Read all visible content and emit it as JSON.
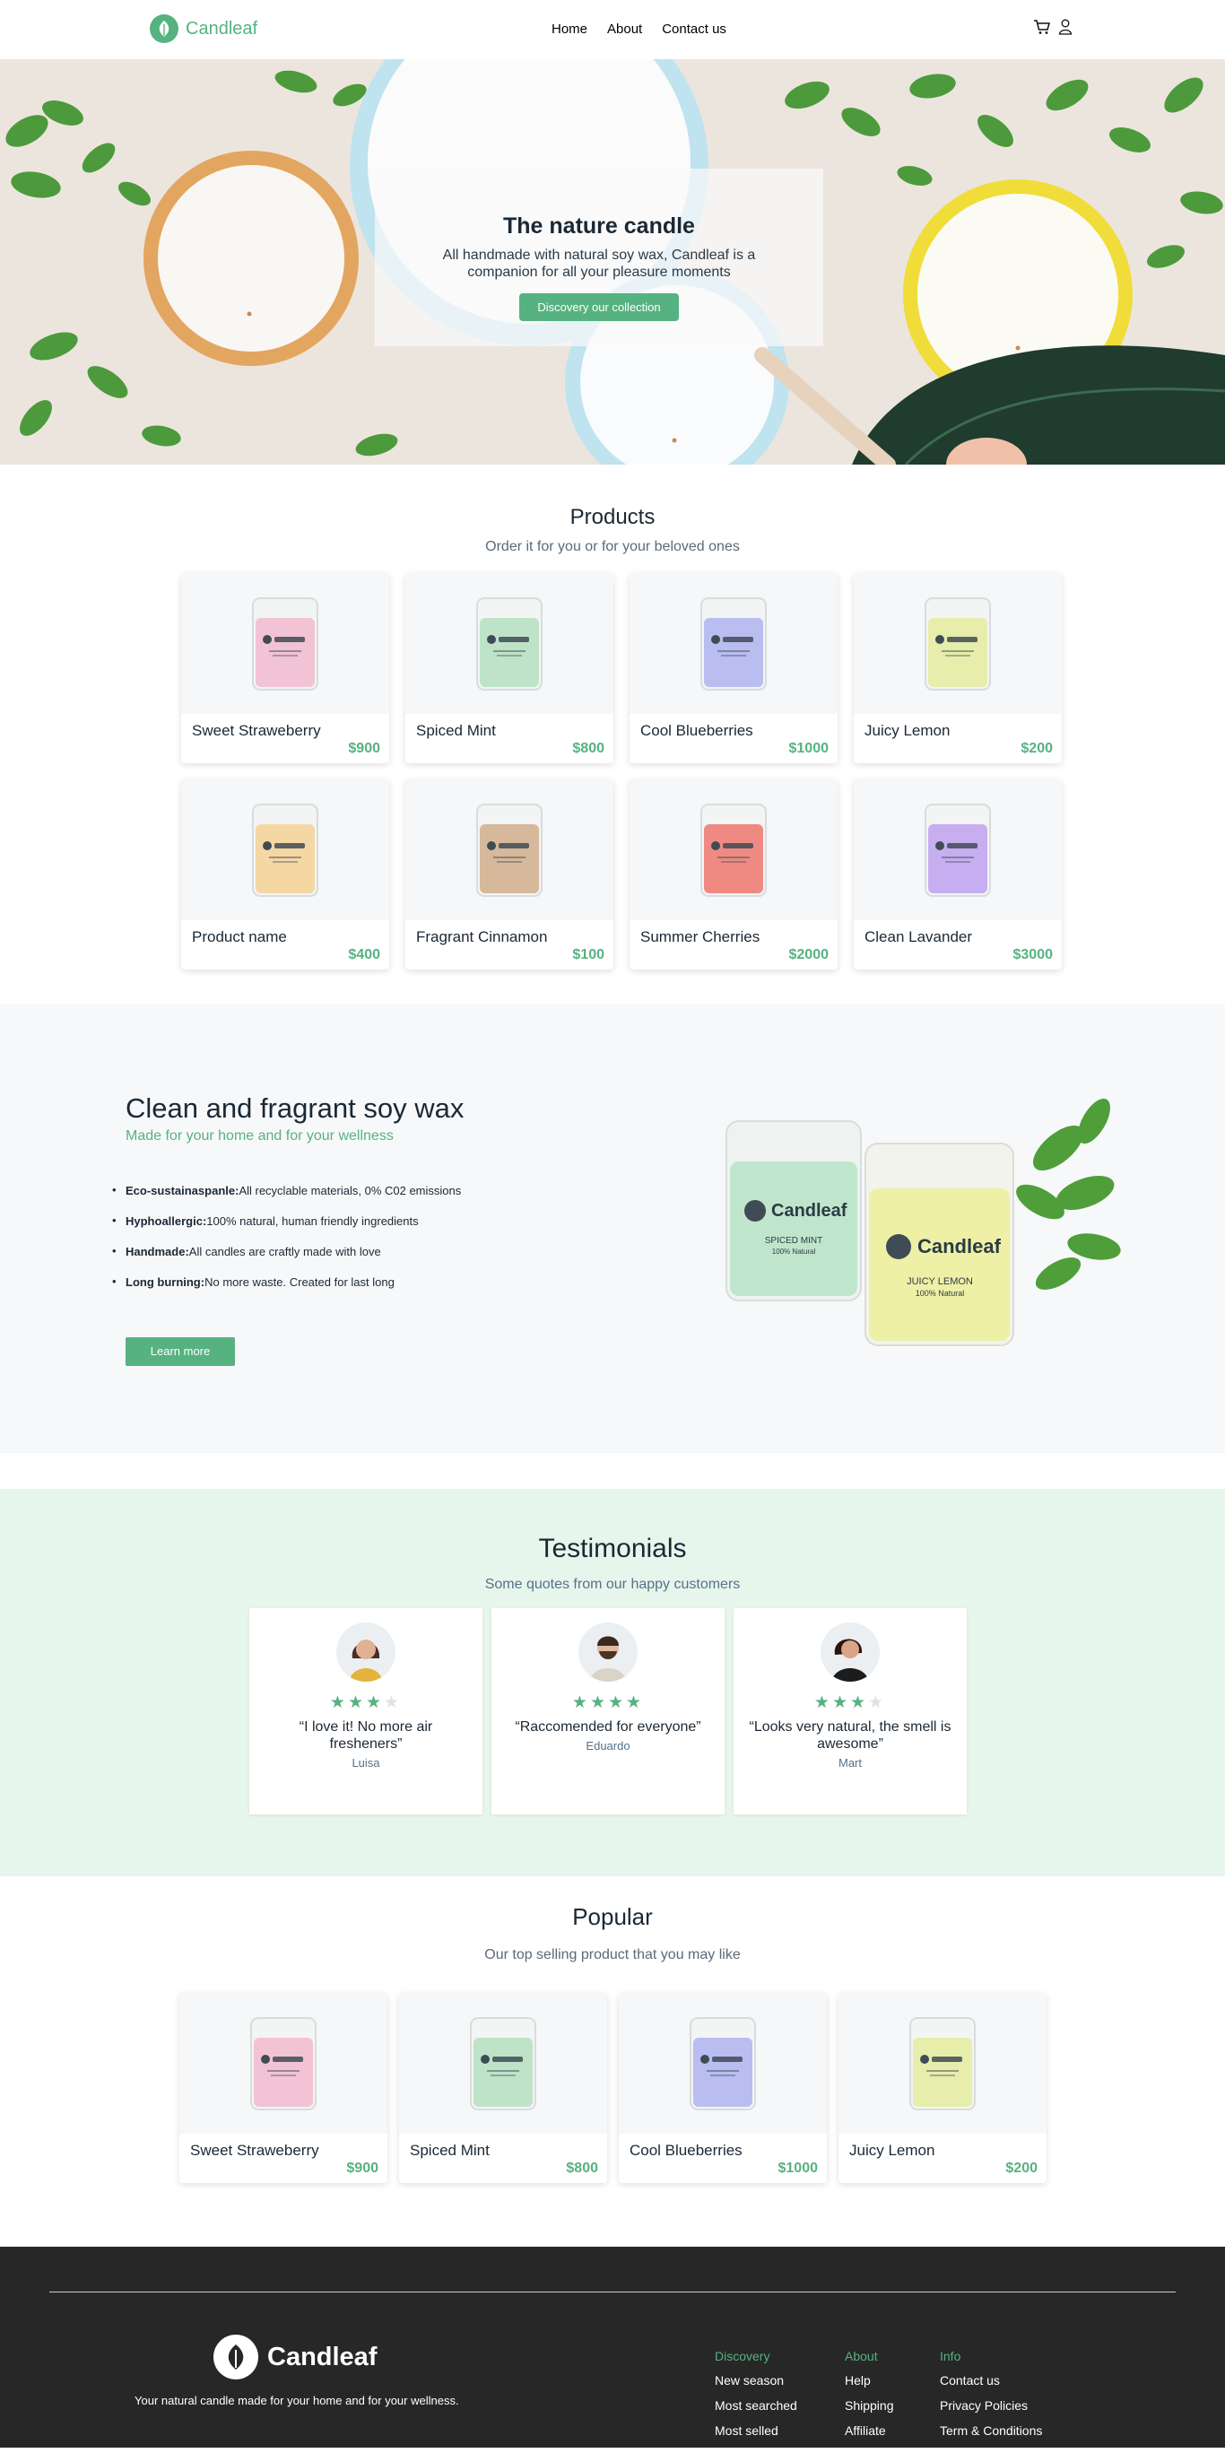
{
  "nav": {
    "brand": "Candleaf",
    "menu": [
      "Home",
      "About",
      "Contact us"
    ]
  },
  "hero": {
    "title": "The nature candle",
    "subtitle": "All handmade with natural soy wax, Candleaf is a companion for all your pleasure moments",
    "cta": "Discovery our collection"
  },
  "products": {
    "title": "Products",
    "subtitle": "Order it for you or for your beloved ones",
    "items": [
      {
        "name": "Sweet Straweberry",
        "price": "$900",
        "color": "#f2c3d4"
      },
      {
        "name": "Spiced Mint",
        "price": "$800",
        "color": "#bfe3c9"
      },
      {
        "name": "Cool Blueberries",
        "price": "$1000",
        "color": "#b9bdf0"
      },
      {
        "name": "Juicy Lemon",
        "price": "$200",
        "color": "#e7edaa"
      },
      {
        "name": "Product name",
        "price": "$400",
        "color": "#f4d7a2"
      },
      {
        "name": "Fragrant Cinnamon",
        "price": "$100",
        "color": "#d6b89b"
      },
      {
        "name": "Summer Cherries",
        "price": "$2000",
        "color": "#ef8a83"
      },
      {
        "name": "Clean Lavander",
        "price": "$3000",
        "color": "#c7aef0"
      }
    ]
  },
  "features": {
    "title": "Clean and fragrant soy wax",
    "subtitle": "Made for your home and for your wellness",
    "bullets": [
      {
        "label": "Eco-sustainaspanle:",
        "text": "All recyclable materials, 0% C02 emissions"
      },
      {
        "label": "Hyphoallergic:",
        "text": "100% natural, human friendly ingredients"
      },
      {
        "label": "Handmade:",
        "text": "All candles are craftly made with love"
      },
      {
        "label": "Long burning:",
        "text": "No more waste. Created for last long"
      }
    ],
    "cta": "Learn more",
    "jar_brand": "Candleaf",
    "jar_mint": "SPICED MINT",
    "jar_lemon": "JUICY LEMON",
    "jar_natural": "100% Natural"
  },
  "testimonials": {
    "title": "Testimonials",
    "subtitle": "Some quotes from our happy customers",
    "items": [
      {
        "quote": "“I love it! No more air fresheners”",
        "name": "Luisa",
        "rating": 3
      },
      {
        "quote": "“Raccomended for everyone”",
        "name": "Eduardo",
        "rating": 4
      },
      {
        "quote": "“Looks very natural, the smell is awesome”",
        "name": "Mart",
        "rating": 3
      }
    ]
  },
  "popular": {
    "title": "Popular",
    "subtitle": "Our top selling product that you may like",
    "items": [
      {
        "name": "Sweet Straweberry",
        "price": "$900",
        "color": "#f2c3d4"
      },
      {
        "name": "Spiced Mint",
        "price": "$800",
        "color": "#bfe3c9"
      },
      {
        "name": "Cool Blueberries",
        "price": "$1000",
        "color": "#b9bdf0"
      },
      {
        "name": "Juicy Lemon",
        "price": "$200",
        "color": "#e7edaa"
      }
    ]
  },
  "footer": {
    "brand": "Candleaf",
    "tagline": "Your natural candle made for your home and for your wellness.",
    "columns": [
      {
        "title": "Discovery",
        "links": [
          "New season",
          "Most searched",
          "Most selled"
        ]
      },
      {
        "title": "About",
        "links": [
          "Help",
          "Shipping",
          "Affiliate"
        ]
      },
      {
        "title": "Info",
        "links": [
          "Contact us",
          "Privacy Policies",
          "Term & Conditions"
        ]
      }
    ]
  },
  "colors": {
    "accent": "#56b280",
    "dark": "#1b2834",
    "footer_bg": "#272727",
    "testimonial_bg": "#e7f6ec"
  },
  "icons": {
    "cart": "cart-icon",
    "user": "user-icon",
    "leaf": "leaf-icon"
  }
}
